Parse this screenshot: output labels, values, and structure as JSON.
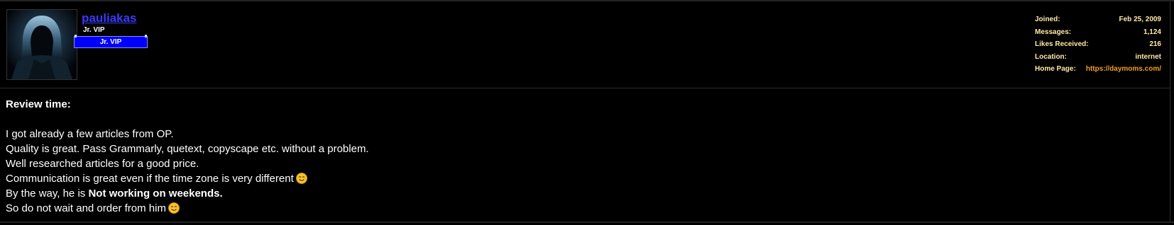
{
  "user": {
    "username": "pauliakas",
    "rank": "Jr. VIP",
    "rank_banner": "Jr. VIP"
  },
  "stats": [
    {
      "label": "Joined:",
      "value": "Feb 25, 2009"
    },
    {
      "label": "Messages:",
      "value": "1,124"
    },
    {
      "label": "Likes Received:",
      "value": "216"
    },
    {
      "label": "Location:",
      "value": "internet"
    },
    {
      "label": "Home Page:",
      "value": "https://daymoms.com/"
    }
  ],
  "post": {
    "heading": "Review time:",
    "line1": "I got already a few articles from OP.",
    "line2": "Quality is great. Pass Grammarly, quetext, copyscape etc. without a problem.",
    "line3": "Well researched articles for a good price.",
    "line4": "Communication is great even if the time zone is very different",
    "line5_prefix": "By the way, he is ",
    "line5_bold": "Not working on weekends.",
    "line6": "So do not wait and order from him"
  },
  "icons": {
    "avatar": "hooded-figure-avatar",
    "smile": "smile-emoji-icon"
  },
  "colors": {
    "background": "#000000",
    "username": "#3a3aff",
    "rank_banner": "#0000ff",
    "stats_text": "#ffe9a8",
    "homepage_link": "#f0a020"
  }
}
